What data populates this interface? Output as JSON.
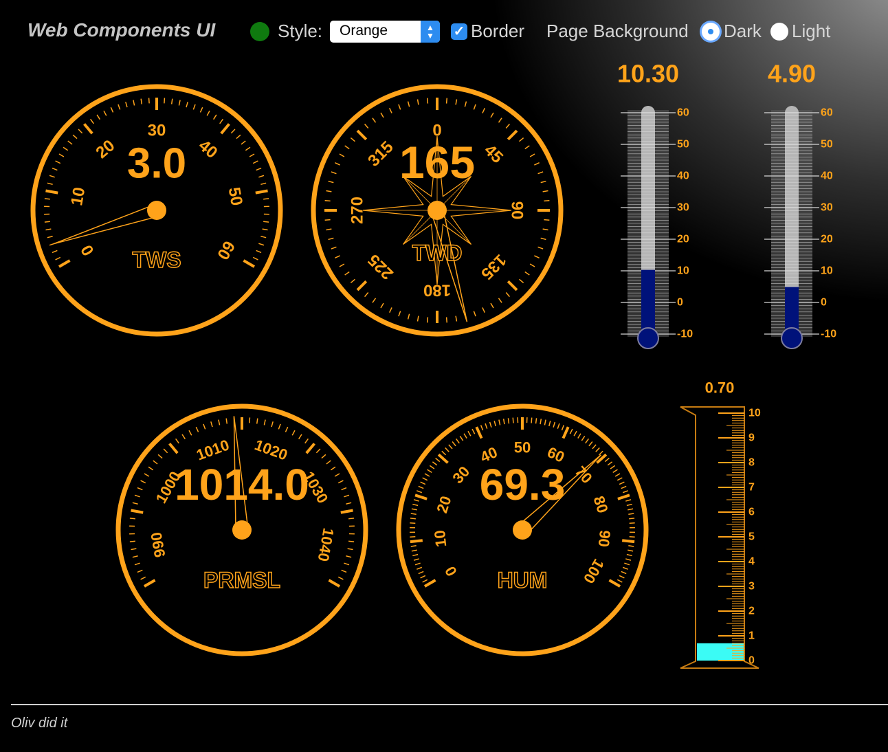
{
  "app": {
    "title": "Web Components UI"
  },
  "toolbar": {
    "status_color": "#0f7a0f",
    "style_label": "Style:",
    "style_value": "Orange",
    "border_label": "Border",
    "border_checked": true,
    "bg_label": "Page Background",
    "bg_dark": "Dark",
    "bg_light": "Light",
    "bg_selected": "Dark"
  },
  "theme": {
    "accent": "#ffa31a",
    "accent_dim": "#c77c12",
    "thermo_fill": "#00127a",
    "tube_fill": "#3bfbf5",
    "background": "#000000"
  },
  "gauges": {
    "tws": {
      "label": "TWS",
      "value": "3.0",
      "min": 0,
      "max": 60,
      "ticks": [
        "0",
        "10",
        "20",
        "30",
        "40",
        "50",
        "60"
      ]
    },
    "twd": {
      "label": "TWD",
      "value": "165",
      "ticks": [
        "0",
        "45",
        "90",
        "135",
        "180",
        "225",
        "270",
        "315"
      ]
    },
    "prmsl": {
      "label": "PRMSL",
      "value": "1014.0",
      "min": 985,
      "max": 1045,
      "ticks": [
        "990",
        "1000",
        "1010",
        "1020",
        "1030",
        "1040"
      ]
    },
    "hum": {
      "label": "HUM",
      "value": "69.3",
      "min": 0,
      "max": 100,
      "ticks": [
        "0",
        "10",
        "20",
        "30",
        "40",
        "50",
        "60",
        "70",
        "80",
        "90",
        "100"
      ]
    }
  },
  "thermometers": [
    {
      "value": "10.30",
      "ticks": [
        "60",
        "50",
        "40",
        "30",
        "20",
        "10",
        "0",
        "-10"
      ]
    },
    {
      "value": "4.90",
      "ticks": [
        "60",
        "50",
        "40",
        "30",
        "20",
        "10",
        "0",
        "-10"
      ]
    }
  ],
  "rain": {
    "value": "0.70",
    "ticks": [
      "10",
      "9",
      "8",
      "7",
      "6",
      "5",
      "4",
      "3",
      "2",
      "1",
      "0"
    ]
  },
  "footer": {
    "text": "Oliv did it"
  }
}
